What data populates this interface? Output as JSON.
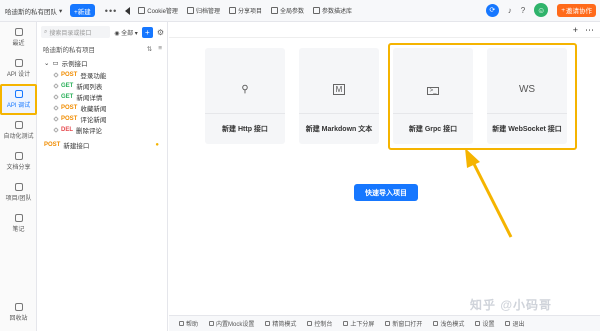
{
  "topbar": {
    "team_name": "哈迪斯的私有团队",
    "new_label": "+新建",
    "tools": [
      {
        "label": "Cookie管理",
        "icon": "cookie-icon"
      },
      {
        "label": "归档管理",
        "icon": "archive-icon"
      },
      {
        "label": "分享项目",
        "icon": "share-icon"
      },
      {
        "label": "全局参数",
        "icon": "params-icon"
      },
      {
        "label": "参数描述库",
        "icon": "library-icon"
      }
    ],
    "invite_label": "邀请协作"
  },
  "rail": {
    "items": [
      {
        "label": "最近",
        "icon": "recent-icon"
      },
      {
        "label": "API 设计",
        "icon": "design-icon"
      },
      {
        "label": "API 调试",
        "icon": "debug-icon"
      },
      {
        "label": "自动化测试",
        "icon": "autotest-icon"
      },
      {
        "label": "文档分享",
        "icon": "doc-share-icon"
      },
      {
        "label": "项目/团队",
        "icon": "team-icon"
      },
      {
        "label": "笔记",
        "icon": "note-icon"
      }
    ],
    "bottom_label": "回收站"
  },
  "tree": {
    "search_placeholder": "搜索目录或接口",
    "filter_value": "全部",
    "project_title": "哈迪斯的私有项目",
    "folder": "示例接口",
    "items": [
      {
        "method": "POST",
        "name": "登录功能"
      },
      {
        "method": "GET",
        "name": "新闻列表"
      },
      {
        "method": "GET",
        "name": "新闻详情"
      },
      {
        "method": "POST",
        "name": "收藏新闻"
      },
      {
        "method": "POST",
        "name": "评论新闻"
      },
      {
        "method": "DEL",
        "name": "删除评论"
      }
    ],
    "new_item": {
      "method": "POST",
      "name": "新建接口"
    }
  },
  "main": {
    "cards": [
      {
        "glyph": "⚲",
        "label": "新建 Http 接口"
      },
      {
        "glyph": "M",
        "label": "新建 Markdown 文本"
      },
      {
        "glyph": ">_",
        "label": "新建 Grpc 接口"
      },
      {
        "glyph": "WS",
        "label": "新建 WebSocket 接口"
      }
    ],
    "quick_import": "快速导入项目"
  },
  "bottombar": {
    "items": [
      "帮助",
      "内置Mock设置",
      "精简模式",
      "控制台",
      "上下分屏",
      "新窗口打开",
      "浅色模式",
      "设置",
      "退出"
    ]
  },
  "watermark": "知乎 @小码哥"
}
